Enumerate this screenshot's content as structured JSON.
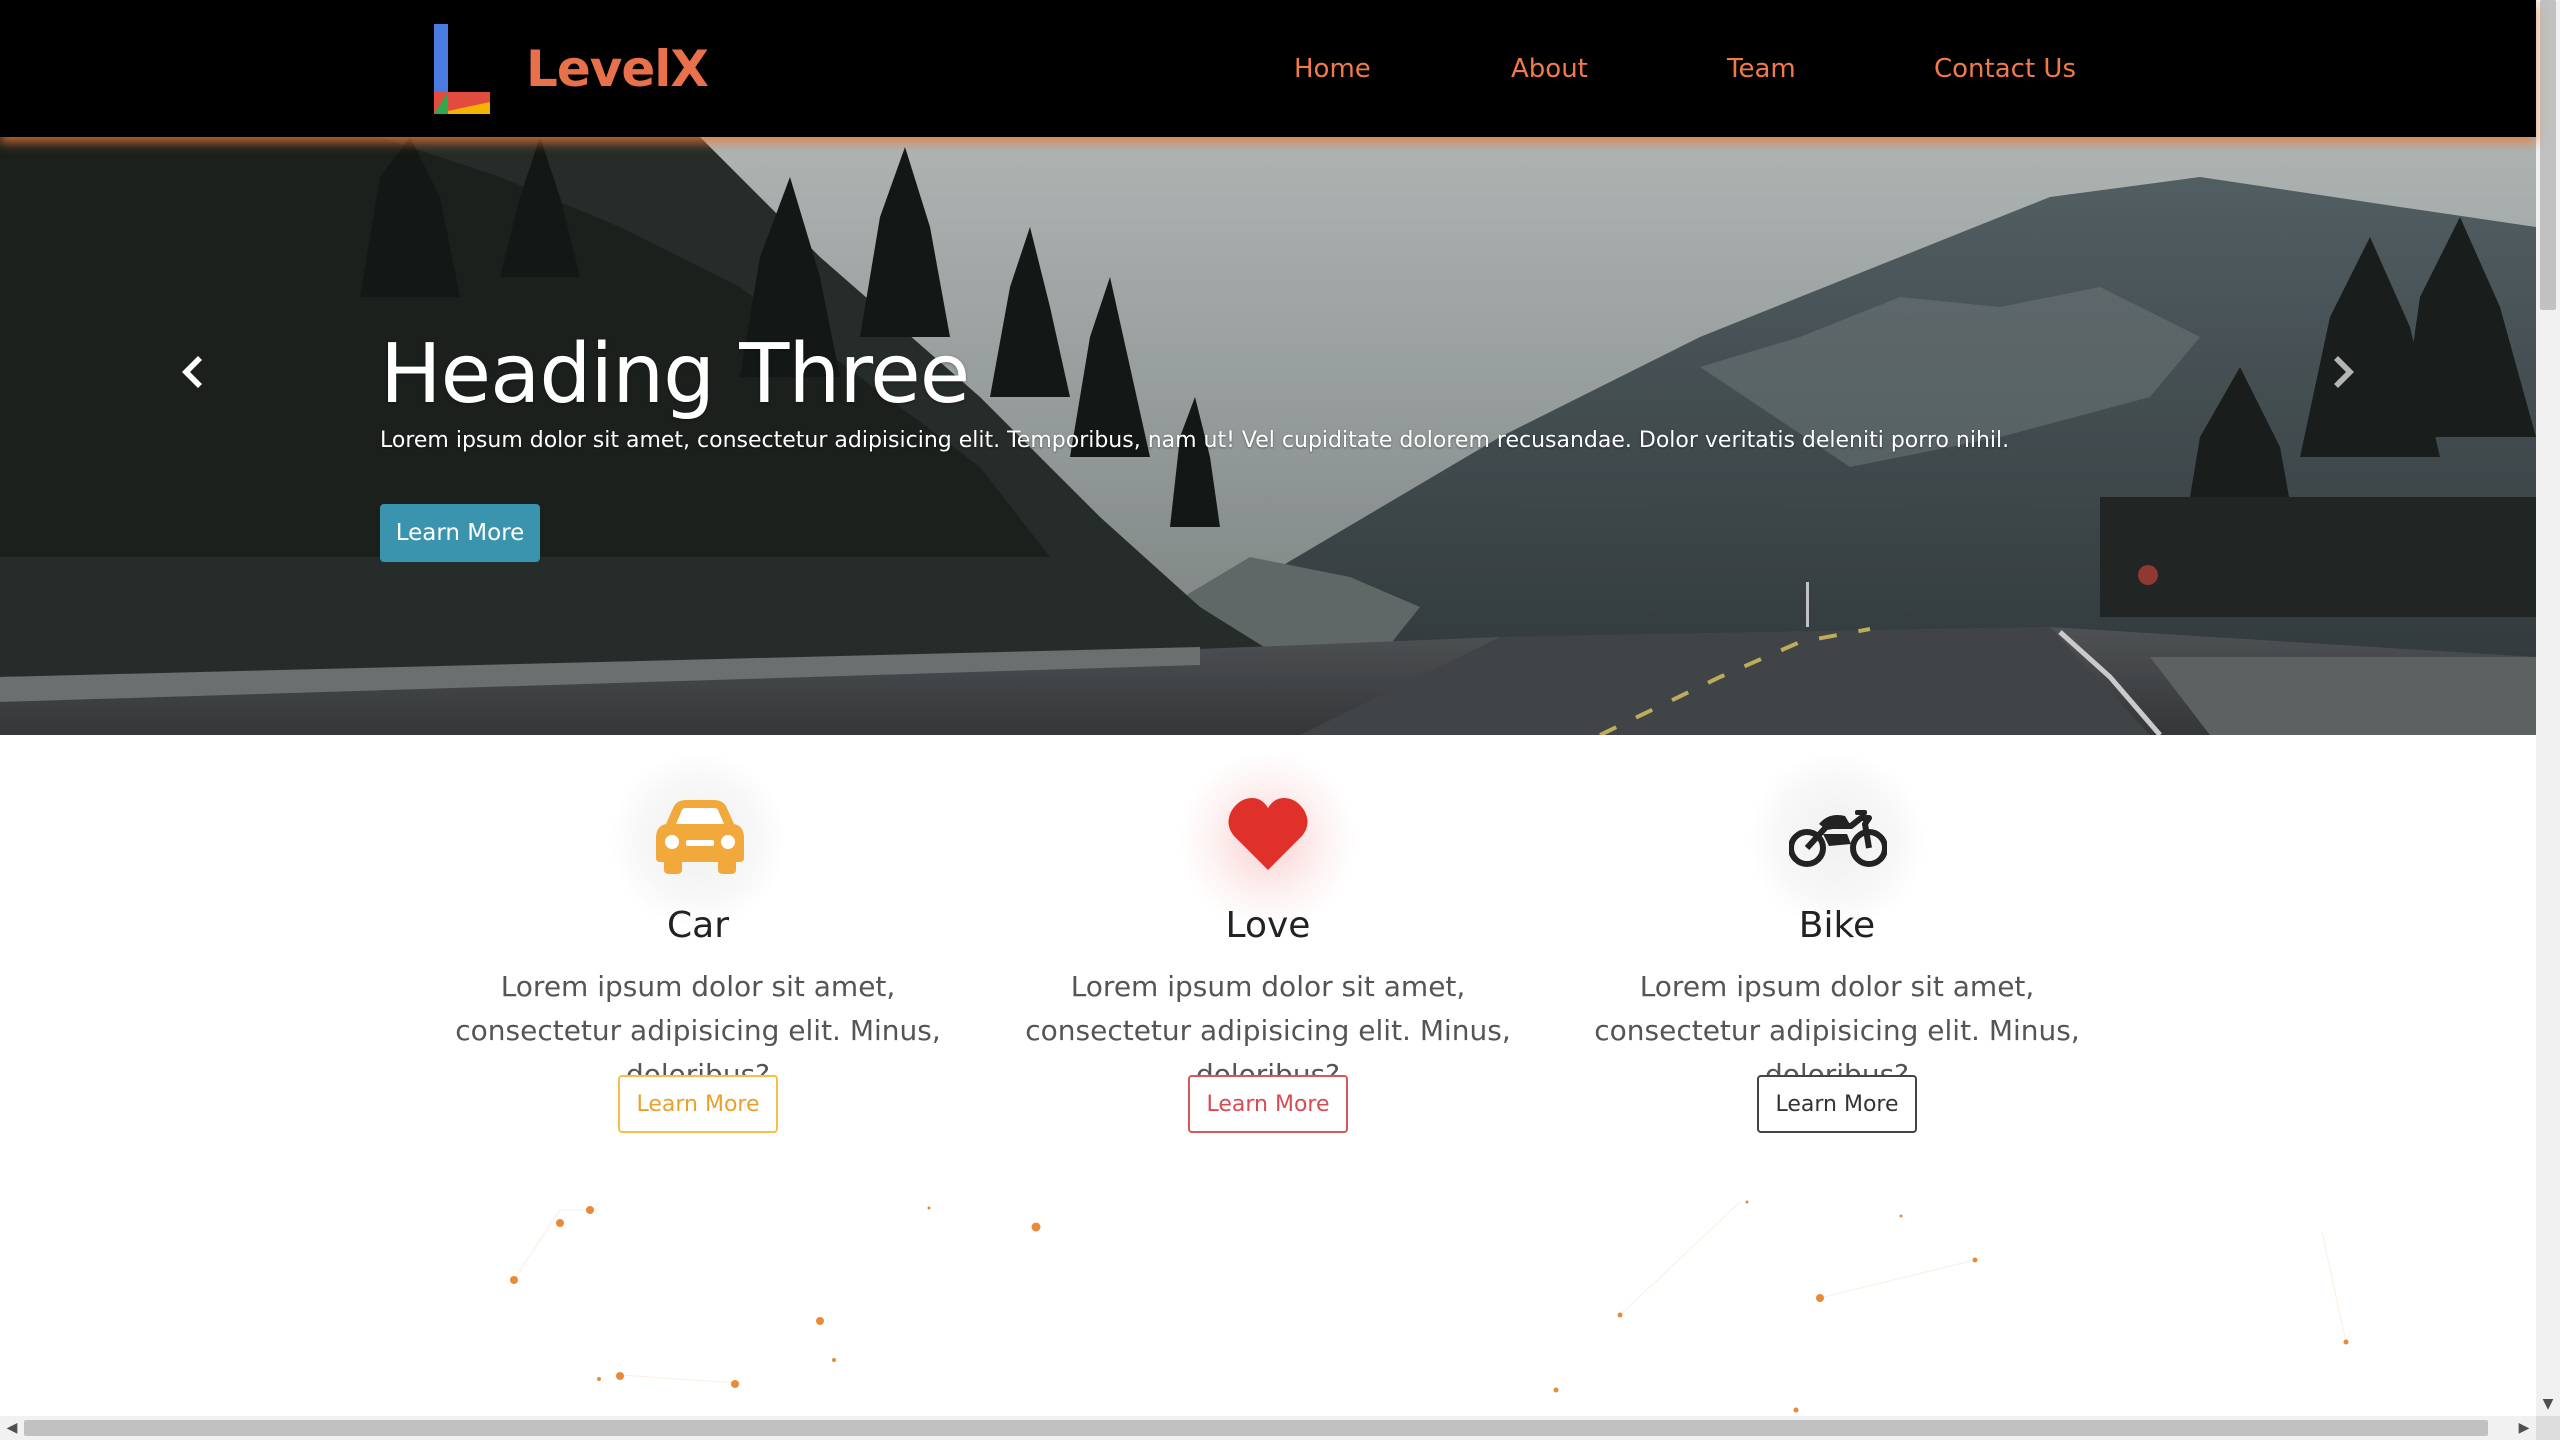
{
  "navbar": {
    "brand": "LevelX",
    "links": [
      {
        "label": "Home"
      },
      {
        "label": "About"
      },
      {
        "label": "Team"
      },
      {
        "label": "Contact Us"
      }
    ]
  },
  "hero": {
    "heading": "Heading Three",
    "text": "Lorem ipsum dolor sit amet, consectetur adipisicing elit. Temporibus, nam ut! Vel cupiditate dolorem recusandae. Dolor veritatis deleniti porro nihil.",
    "button_label": "Learn More",
    "button_color": "#3a94ad",
    "prev_icon": "chevron-left-icon",
    "next_icon": "chevron-right-icon"
  },
  "features": [
    {
      "icon": "car-icon",
      "icon_color": "#f2a93b",
      "title": "Car",
      "text": "Lorem ipsum dolor sit amet, consectetur adipisicing elit. Minus, doloribus?",
      "button_label": "Learn More"
    },
    {
      "icon": "heart-icon",
      "icon_color": "#e0302a",
      "title": "Love",
      "text": "Lorem ipsum dolor sit amet, consectetur adipisicing elit. Minus, doloribus?",
      "button_label": "Learn More"
    },
    {
      "icon": "motorcycle-icon",
      "icon_color": "#222222",
      "title": "Bike",
      "text": "Lorem ipsum dolor sit amet, consectetur adipisicing elit. Minus, doloribus?",
      "button_label": "Learn More"
    }
  ],
  "colors": {
    "accent": "#e8704a",
    "navbar_bg": "#000000",
    "particle": "#e88a3a"
  }
}
